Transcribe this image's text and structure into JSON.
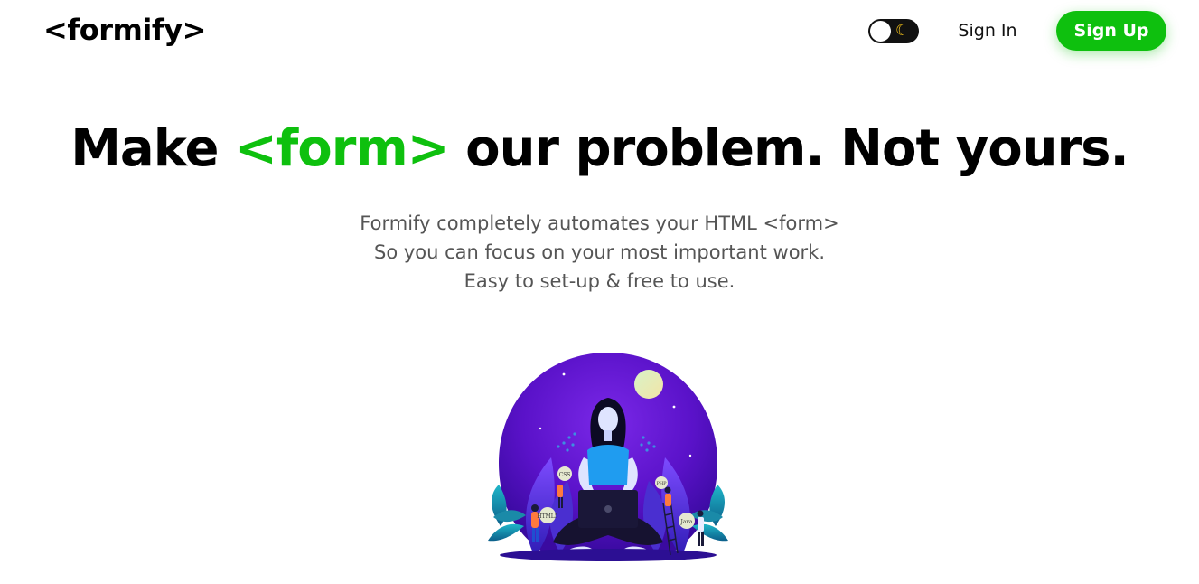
{
  "header": {
    "logo": "<formify>",
    "theme_toggle": {
      "state": "light",
      "icon": "moon-icon"
    },
    "sign_in_label": "Sign In",
    "sign_up_label": "Sign Up"
  },
  "hero": {
    "headline_before": "Make ",
    "headline_accent": "<form>",
    "headline_after": " our problem. Not yours.",
    "subtext": [
      "Formify completely automates your HTML <form>",
      "So you can focus on your most important work.",
      "Easy to set-up & free to use."
    ],
    "illustration_labels": [
      "CSS",
      "HTML5",
      "PHP",
      "Java"
    ]
  },
  "colors": {
    "accent": "#0ec00e",
    "text": "#000000",
    "muted_text": "#555555",
    "illustration_purple": "#5a12c9"
  }
}
